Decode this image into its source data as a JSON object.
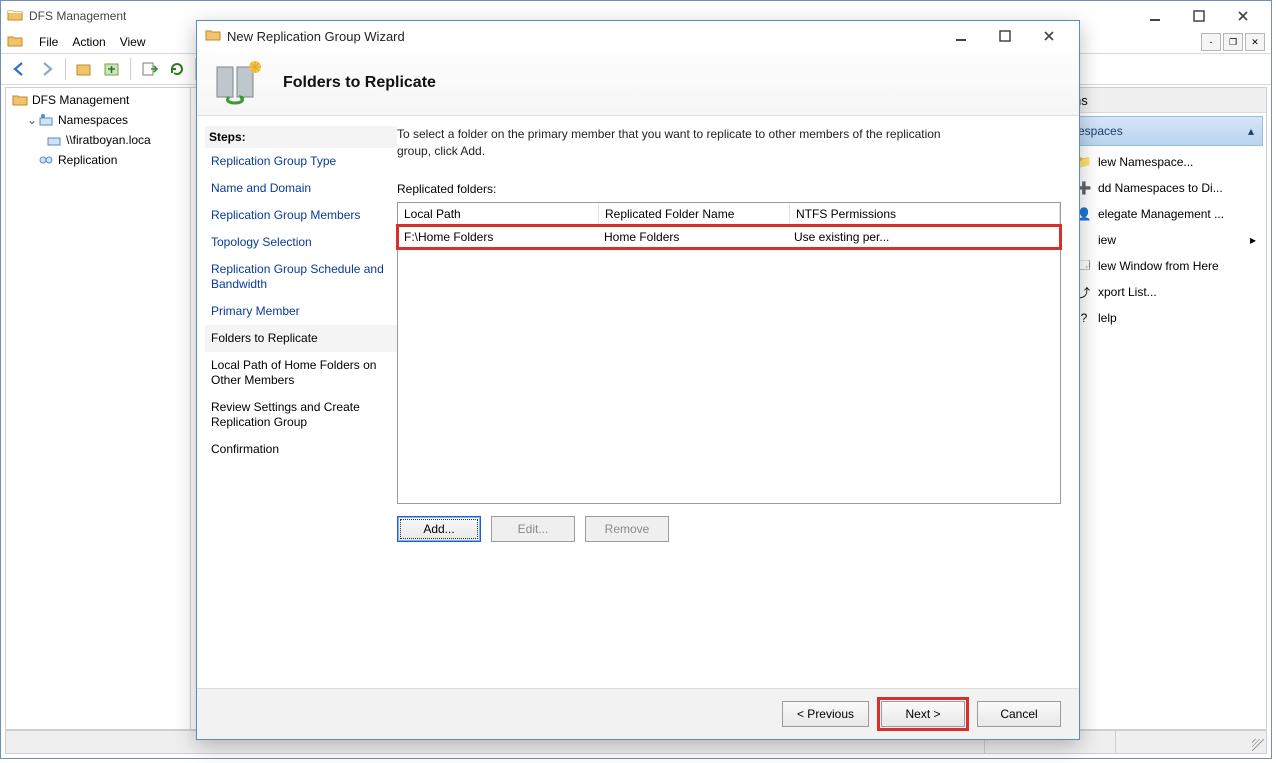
{
  "main_window": {
    "title": "DFS Management",
    "menu": {
      "file": "File",
      "action": "Action",
      "view": "View"
    },
    "tree": {
      "root": "DFS Management",
      "namespaces": "Namespaces",
      "namespace_item": "\\\\firatboyan.loca",
      "replication": "Replication"
    },
    "actions": {
      "pane_title": "ns",
      "section": "espaces",
      "items": [
        {
          "label": "lew Namespace...",
          "arrow": false
        },
        {
          "label": "dd Namespaces to Di...",
          "arrow": false
        },
        {
          "label": "elegate Management ...",
          "arrow": false
        },
        {
          "label": "iew",
          "arrow": true
        },
        {
          "label": "lew Window from Here",
          "arrow": false
        },
        {
          "label": "xport List...",
          "arrow": false
        },
        {
          "label": "lelp",
          "arrow": false
        }
      ]
    }
  },
  "wizard": {
    "title": "New Replication Group Wizard",
    "heading": "Folders to Replicate",
    "steps_label": "Steps:",
    "steps": [
      {
        "label": "Replication Group Type",
        "kind": "link"
      },
      {
        "label": "Name and Domain",
        "kind": "link"
      },
      {
        "label": "Replication Group Members",
        "kind": "link"
      },
      {
        "label": "Topology Selection",
        "kind": "link"
      },
      {
        "label": "Replication Group Schedule and Bandwidth",
        "kind": "link"
      },
      {
        "label": "Primary Member",
        "kind": "link"
      },
      {
        "label": "Folders to Replicate",
        "kind": "current"
      },
      {
        "label": "Local Path of Home Folders on Other Members",
        "kind": "future"
      },
      {
        "label": "Review Settings and Create Replication Group",
        "kind": "future"
      },
      {
        "label": "Confirmation",
        "kind": "future"
      }
    ],
    "instruction": "To select a folder on the primary member that you want to replicate to other members of the replication group, click Add.",
    "list_label": "Replicated folders:",
    "columns": {
      "c1": "Local Path",
      "c2": "Replicated Folder Name",
      "c3": "NTFS Permissions"
    },
    "rows": [
      {
        "c1": "F:\\Home Folders",
        "c2": "Home Folders",
        "c3": "Use existing per..."
      }
    ],
    "buttons": {
      "add": "Add...",
      "edit": "Edit...",
      "remove": "Remove"
    },
    "footer": {
      "previous": "< Previous",
      "next": "Next >",
      "cancel": "Cancel"
    }
  }
}
